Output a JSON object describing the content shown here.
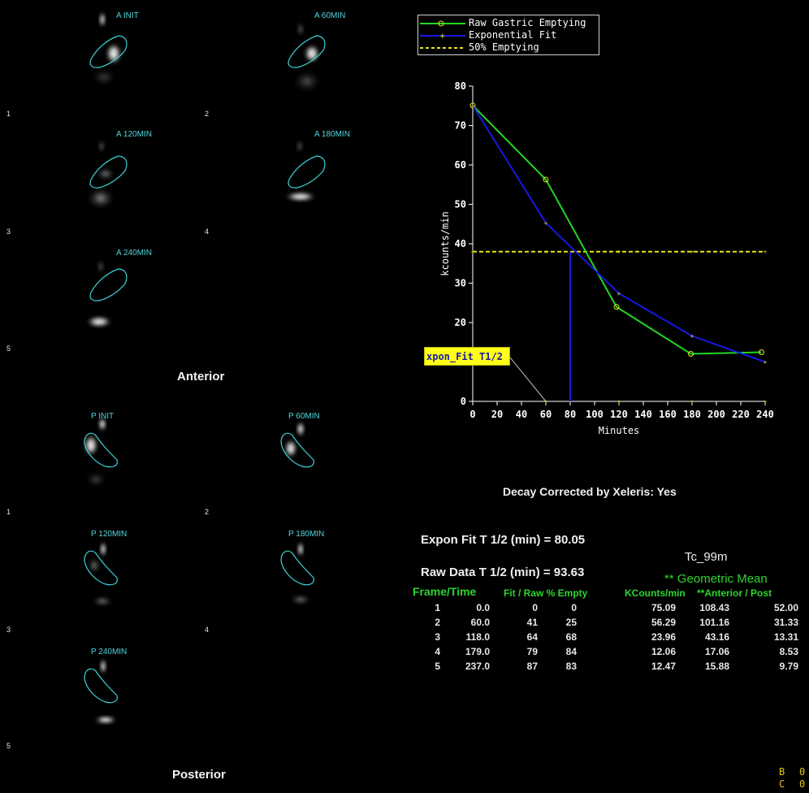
{
  "anterior": {
    "label": "Anterior",
    "frames": [
      {
        "label": "A INIT",
        "index": "1"
      },
      {
        "label": "A 60MIN",
        "index": "2"
      },
      {
        "label": "A 120MIN",
        "index": "3"
      },
      {
        "label": "A 180MIN",
        "index": "4"
      },
      {
        "label": "A 240MIN",
        "index": "5"
      }
    ]
  },
  "posterior": {
    "label": "Posterior",
    "frames": [
      {
        "label": "P INIT",
        "index": "1"
      },
      {
        "label": "P 60MIN",
        "index": "2"
      },
      {
        "label": "P 120MIN",
        "index": "3"
      },
      {
        "label": "P 180MIN",
        "index": "4"
      },
      {
        "label": "P 240MIN",
        "index": "5"
      }
    ]
  },
  "legend": {
    "raw": "Raw Gastric Emptying",
    "fit": "Exponential Fit",
    "half": "50% Emptying"
  },
  "tooltip": "xpon_Fit T1/2",
  "colors": {
    "raw": "#22d622",
    "fit": "#1818e0",
    "half": "#e6e61a",
    "roi": "#3fcfd6",
    "tooltip_bg": "#ffff1a",
    "table_header": "#2fd42f"
  },
  "chart_data": {
    "type": "line",
    "xlabel": "Minutes",
    "ylabel": "kcounts/min",
    "xlim": [
      0,
      240
    ],
    "ylim": [
      0,
      80
    ],
    "xticks": [
      0,
      20,
      40,
      60,
      80,
      100,
      120,
      140,
      160,
      180,
      200,
      220,
      240
    ],
    "yticks": [
      0,
      10,
      20,
      30,
      40,
      50,
      60,
      70,
      80
    ],
    "series": [
      {
        "name": "Raw Gastric Emptying",
        "x": [
          0,
          60,
          118,
          179,
          237
        ],
        "y": [
          75.09,
          56.29,
          23.96,
          12.06,
          12.47
        ]
      },
      {
        "name": "Exponential Fit",
        "x": [
          0,
          60,
          120,
          180,
          240
        ],
        "y": [
          75.1,
          45.3,
          27.4,
          16.6,
          10.0
        ]
      },
      {
        "name": "50% Emptying",
        "x": [
          0,
          60,
          120,
          180,
          240
        ],
        "y": [
          38.0,
          38.0,
          38.0,
          38.0,
          38.0
        ]
      }
    ],
    "t_half_marker_x": 80,
    "axis_markers_x": [
      60,
      120,
      180,
      240
    ],
    "legend_position": "top"
  },
  "results": {
    "decay": "Decay Corrected by Xeleris: Yes",
    "expon": "Expon Fit T 1/2 (min) = 80.05",
    "raw": "Raw Data T 1/2 (min) = 93.63",
    "isotope": "Tc_99m",
    "geo_mean": "** Geometric Mean"
  },
  "table": {
    "headers": {
      "frame_time": "Frame/Time",
      "fit_raw": "Fit / Raw % Empty",
      "kcounts": "KCounts/min",
      "antpost": "**Anterior / Post"
    },
    "rows": [
      {
        "frame": "1",
        "time": "0.0",
        "fit": "0",
        "raw": "0",
        "kc": "75.09",
        "ant": "108.43",
        "post": "52.00"
      },
      {
        "frame": "2",
        "time": "60.0",
        "fit": "41",
        "raw": "25",
        "kc": "56.29",
        "ant": "101.16",
        "post": "31.33"
      },
      {
        "frame": "3",
        "time": "118.0",
        "fit": "64",
        "raw": "68",
        "kc": "23.96",
        "ant": "43.16",
        "post": "13.31"
      },
      {
        "frame": "4",
        "time": "179.0",
        "fit": "79",
        "raw": "84",
        "kc": "12.06",
        "ant": "17.06",
        "post": "8.53"
      },
      {
        "frame": "5",
        "time": "237.0",
        "fit": "87",
        "raw": "83",
        "kc": "12.47",
        "ant": "15.88",
        "post": "9.79"
      }
    ]
  },
  "corner": {
    "b_label": "B",
    "b_value": "0",
    "c_label": "C",
    "c_value": "0"
  }
}
